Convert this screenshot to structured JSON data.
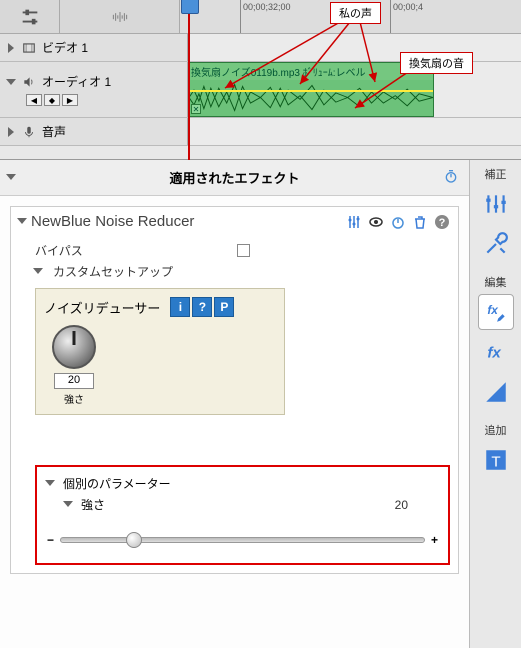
{
  "timeline": {
    "ruler": {
      "t1": "00;00;32;00",
      "t2": "00;00;4"
    },
    "video_track": "ビデオ 1",
    "audio_track": "オーディオ 1",
    "voice_track": "音声",
    "clip_label": "換気扇ノイズ0119b.mp3 ﾎﾞﾘｭｰﾑ:レベル",
    "callout1": "私の声",
    "callout2": "換気扇の音"
  },
  "fx": {
    "header": "適用されたエフェクト",
    "effect_name": "NewBlue Noise Reducer",
    "bypass": "バイパス",
    "custom_setup": "カスタムセットアップ",
    "reducer_title": "ノイズリデューサー",
    "btn_i": "i",
    "btn_q": "?",
    "btn_p": "P",
    "knob_value": "20",
    "knob_label": "強さ",
    "params_title": "個別のパラメーター",
    "param_strength": "強さ",
    "param_value": "20",
    "minus": "−",
    "plus": "+"
  },
  "sidebar": {
    "correct": "補正",
    "edit": "編集",
    "add": "追加"
  }
}
